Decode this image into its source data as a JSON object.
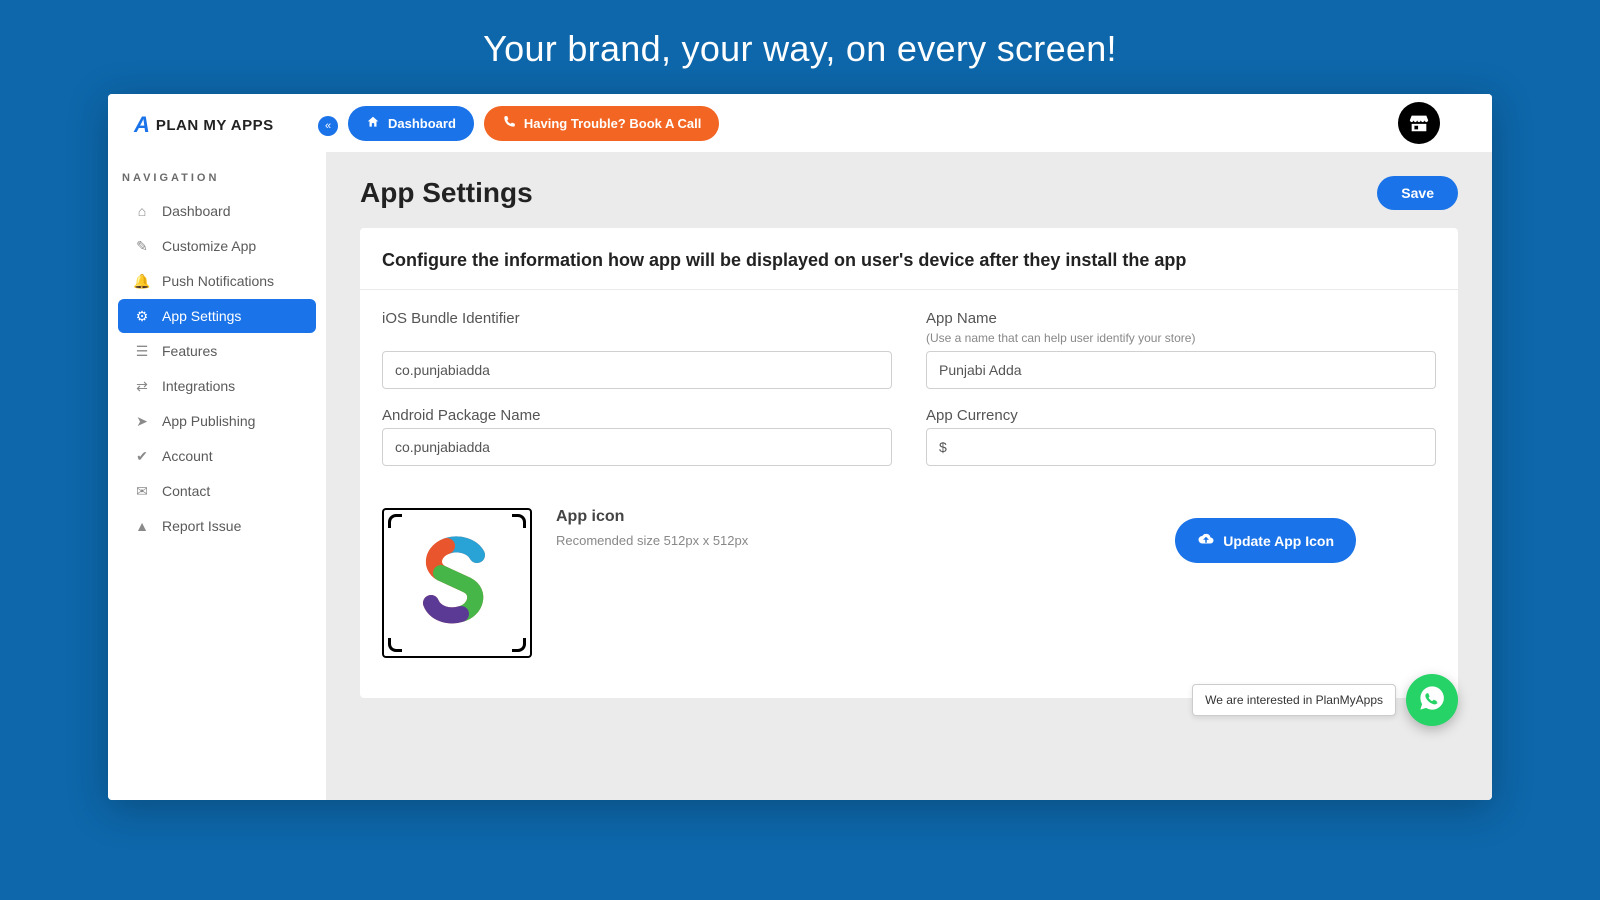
{
  "hero": "Your brand, your way, on every screen!",
  "brand": {
    "mark": "A",
    "text": "PLAN MY APPS"
  },
  "nav_title": "NAVIGATION",
  "nav": [
    {
      "label": "Dashboard",
      "icon": "home-icon"
    },
    {
      "label": "Customize App",
      "icon": "brush-icon"
    },
    {
      "label": "Push Notifications",
      "icon": "bell-icon"
    },
    {
      "label": "App Settings",
      "icon": "gear-icon",
      "active": true
    },
    {
      "label": "Features",
      "icon": "list-icon"
    },
    {
      "label": "Integrations",
      "icon": "plug-icon"
    },
    {
      "label": "App Publishing",
      "icon": "send-icon"
    },
    {
      "label": "Account",
      "icon": "shield-icon"
    },
    {
      "label": "Contact",
      "icon": "mail-icon"
    },
    {
      "label": "Report Issue",
      "icon": "warning-icon"
    }
  ],
  "topbar": {
    "dashboard": "Dashboard",
    "book_call": "Having Trouble? Book A Call"
  },
  "page_title": "App Settings",
  "save_label": "Save",
  "card_head": "Configure the information how app will be displayed on user's device after they install the app",
  "fields": {
    "ios_label": "iOS Bundle Identifier",
    "ios_value": "co.punjabiadda",
    "android_label": "Android Package Name",
    "android_value": "co.punjabiadda",
    "appname_label": "App Name",
    "appname_hint": "(Use a name that can help user identify your store)",
    "appname_value": "Punjabi Adda",
    "currency_label": "App Currency",
    "currency_value": "$"
  },
  "icon_section": {
    "title": "App icon",
    "hint": "Recomended size 512px x 512px",
    "update_label": "Update App Icon"
  },
  "whatsapp_msg": "We are interested in PlanMyApps"
}
